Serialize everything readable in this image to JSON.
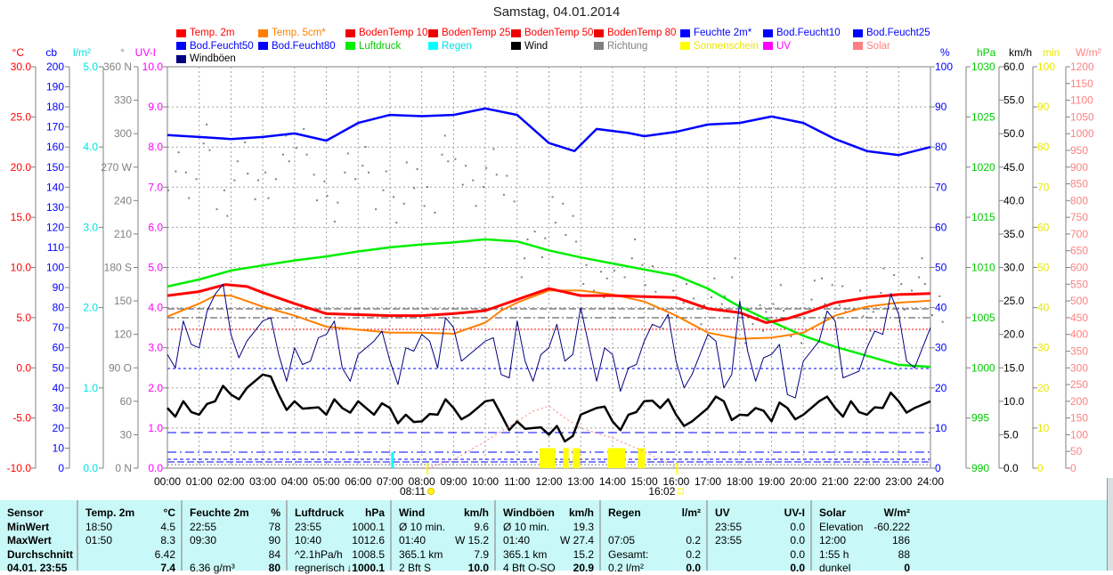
{
  "title": "Samstag, 04.01.2014",
  "legend": [
    {
      "label": "Temp. 2m",
      "color": "#ff0000",
      "text": "#ff0000"
    },
    {
      "label": "Temp. 5cm*",
      "color": "#ff8000",
      "text": "#ff8000"
    },
    {
      "label": "BodenTemp 10",
      "color": "#ee0000",
      "text": "#ff0000"
    },
    {
      "label": "BodenTemp 25",
      "color": "#ee0000",
      "text": "#ff0000"
    },
    {
      "label": "BodenTemp 50",
      "color": "#ee0000",
      "text": "#ff0000"
    },
    {
      "label": "BodenTemp 80",
      "color": "#ee0000",
      "text": "#ff0000"
    },
    {
      "label": "Feuchte 2m*",
      "color": "#0000ff",
      "text": "#0000ff"
    },
    {
      "label": "Bod.Feucht10",
      "color": "#0000ff",
      "text": "#0000ff"
    },
    {
      "label": "Bod.Feucht25",
      "color": "#0000ff",
      "text": "#0000ff"
    },
    {
      "label": "Bod.Feucht50",
      "color": "#0000ff",
      "text": "#0000ff"
    },
    {
      "label": "Bod.Feucht80",
      "color": "#0000ff",
      "text": "#0000ff"
    },
    {
      "label": "Luftdruck",
      "color": "#00ee00",
      "text": "#00cc00"
    },
    {
      "label": "Regen",
      "color": "#00ffff",
      "text": "#00e0e0"
    },
    {
      "label": "Wind",
      "color": "#000000",
      "text": "#000000"
    },
    {
      "label": "Richtung",
      "color": "#808080",
      "text": "#808080"
    },
    {
      "label": "Sonnenschein",
      "color": "#ffff00",
      "text": "#e8e800"
    },
    {
      "label": "UV",
      "color": "#ff00ff",
      "text": "#ff00ff"
    },
    {
      "label": "Solar",
      "color": "#ff8080",
      "text": "#ff8080"
    },
    {
      "label": "Windböen",
      "color": "#000080",
      "text": "#000000"
    }
  ],
  "chart_data": {
    "type": "line",
    "title": "Samstag, 04.01.2014",
    "x_ticks": [
      "00:00",
      "01:00",
      "02:00",
      "03:00",
      "04:00",
      "05:00",
      "06:00",
      "07:00",
      "08:00",
      "09:00",
      "10:00",
      "11:00",
      "12:00",
      "13:00",
      "14:00",
      "15:00",
      "16:00",
      "17:00",
      "18:00",
      "19:00",
      "20:00",
      "21:00",
      "22:00",
      "23:00",
      "24:00"
    ],
    "xlim": [
      0,
      24
    ],
    "sunrise": "08:11",
    "sunset": "16:02",
    "sunrise_h": 8.18,
    "sunset_h": 16.03,
    "axes": {
      "C": {
        "title": "°C",
        "color": "#ff0000",
        "range": [
          -10,
          30
        ],
        "labels": [
          "30.0",
          "25.0",
          "20.0",
          "15.0",
          "10.0",
          "5.0",
          "0.0",
          "-5.0",
          "-10.0"
        ]
      },
      "cb": {
        "title": "cb",
        "color": "#0000ff",
        "range": [
          0,
          200
        ],
        "labels": [
          "200",
          "190",
          "180",
          "170",
          "160",
          "150",
          "140",
          "130",
          "120",
          "110",
          "100",
          "90",
          "80",
          "70",
          "60",
          "50",
          "40",
          "30",
          "20",
          "10",
          "0"
        ]
      },
      "lm2": {
        "title": "l/m²",
        "color": "#00e0e0",
        "range": [
          0,
          5
        ],
        "labels": [
          "5.0",
          "4.0",
          "3.0",
          "2.0",
          "1.0",
          "0.0"
        ]
      },
      "deg": {
        "title": "°",
        "color": "#808080",
        "range": [
          0,
          360
        ],
        "labels": [
          "360 N",
          "330",
          "300",
          "270 W",
          "240",
          "210",
          "180 S",
          "150",
          "120",
          "90 O",
          "60",
          "30",
          "0 N"
        ]
      },
      "uvi": {
        "title": "UV-I",
        "color": "#ff00ff",
        "range": [
          0,
          10
        ],
        "labels": [
          "10.0",
          "9.0",
          "8.0",
          "7.0",
          "6.0",
          "5.0",
          "4.0",
          "3.0",
          "2.0",
          "1.0",
          "0.0"
        ]
      },
      "pct": {
        "title": "%",
        "color": "#0000ff",
        "range": [
          0,
          100
        ],
        "labels": [
          "100",
          "90",
          "80",
          "70",
          "60",
          "50",
          "40",
          "30",
          "20",
          "10",
          "0"
        ]
      },
      "hpa": {
        "title": "hPa",
        "color": "#00cc00",
        "range": [
          990,
          1030
        ],
        "labels": [
          "1030",
          "1025",
          "1020",
          "1015",
          "1010",
          "1005",
          "1000",
          "995",
          "990"
        ]
      },
      "kmh": {
        "title": "km/h",
        "color": "#000000",
        "range": [
          0,
          60
        ],
        "labels": [
          "60.0",
          "55.0",
          "50.0",
          "45.0",
          "40.0",
          "35.0",
          "30.0",
          "25.0",
          "20.0",
          "15.0",
          "10.0",
          "5.0",
          "0.0"
        ]
      },
      "min": {
        "title": "min",
        "color": "#e8e800",
        "range": [
          0,
          100
        ],
        "labels": [
          "100",
          "90",
          "80",
          "70",
          "60",
          "50",
          "40",
          "30",
          "20",
          "10",
          "0"
        ]
      },
      "wm2": {
        "title": "W/m²",
        "color": "#ff8080",
        "range": [
          0,
          1200
        ],
        "labels": [
          "1200",
          "1150",
          "1100",
          "1050",
          "1000",
          "950",
          "900",
          "850",
          "800",
          "750",
          "700",
          "650",
          "600",
          "550",
          "500",
          "450",
          "400",
          "350",
          "300",
          "250",
          "200",
          "150",
          "100",
          "50",
          "0"
        ]
      }
    },
    "series": [
      {
        "name": "Feuchte 2m*",
        "axis": "pct",
        "color": "#0000ff",
        "width": 2.5,
        "x": [
          0,
          1,
          2,
          3,
          4,
          5,
          6,
          7,
          8,
          9,
          10,
          11,
          12,
          12.8,
          13.5,
          14.5,
          15,
          16,
          17,
          18,
          19,
          20,
          21,
          22,
          23,
          24
        ],
        "y": [
          83,
          82.5,
          82,
          82.5,
          83.4,
          81.6,
          86,
          88,
          87.7,
          88,
          89.6,
          88,
          81,
          79,
          84.5,
          83.5,
          82.7,
          83.8,
          85.6,
          86,
          87.6,
          86,
          82,
          79,
          78,
          80
        ]
      },
      {
        "name": "Luftdruck",
        "axis": "hpa",
        "color": "#00ee00",
        "width": 2.5,
        "x": [
          0,
          1,
          2,
          3,
          4,
          5,
          6,
          7,
          8,
          9,
          10,
          11,
          12,
          13,
          14,
          15,
          16,
          17,
          18,
          19,
          20,
          21,
          22,
          23,
          24
        ],
        "y": [
          1008.1,
          1008.8,
          1009.7,
          1010.2,
          1010.7,
          1011.1,
          1011.6,
          1012,
          1012.3,
          1012.5,
          1012.8,
          1012.6,
          1011.7,
          1011,
          1010.4,
          1009.8,
          1009.2,
          1007.9,
          1006.1,
          1004.6,
          1003.2,
          1002.1,
          1001.2,
          1000.3,
          1000.1
        ]
      },
      {
        "name": "Temp. 5cm*",
        "axis": "C",
        "color": "#ff8000",
        "width": 2,
        "x": [
          0,
          1,
          1.5,
          2,
          3,
          4,
          5,
          6,
          7,
          8,
          9,
          10,
          10.5,
          11,
          12,
          13,
          14,
          15,
          16,
          17,
          18,
          19,
          20,
          21,
          22,
          23,
          24
        ],
        "y": [
          5.1,
          6.4,
          7.2,
          7.2,
          6.1,
          5.2,
          4.1,
          3.8,
          3.5,
          3.5,
          3.4,
          4.5,
          5.7,
          6.5,
          7.7,
          7.7,
          7.3,
          6.6,
          5.2,
          3.5,
          2.9,
          3,
          3.5,
          5.2,
          6.1,
          6.5,
          6.7
        ]
      },
      {
        "name": "Temp. 2m",
        "axis": "C",
        "color": "#ff0000",
        "width": 3,
        "x": [
          0,
          1,
          1.83,
          2.5,
          3,
          4,
          5,
          6,
          7,
          8,
          9,
          10,
          11,
          12,
          13,
          14,
          15,
          16,
          17,
          18,
          18.83,
          19.5,
          20,
          21,
          22,
          23,
          24
        ],
        "y": [
          7.2,
          7.6,
          8.3,
          8.1,
          7.5,
          6.4,
          5.4,
          5.3,
          5.2,
          5.2,
          5.4,
          5.7,
          6.8,
          7.9,
          7.2,
          7.2,
          7.1,
          7,
          5.9,
          5.5,
          4.5,
          4.9,
          5.4,
          6.5,
          7,
          7.3,
          7.4
        ]
      },
      {
        "name": "Windböen",
        "axis": "kmh",
        "color": "#000080",
        "width": 1,
        "x": "half-hourly",
        "y": [
          17,
          22,
          18,
          26,
          20,
          19,
          22,
          17,
          18,
          16,
          20,
          15,
          17,
          19,
          16,
          18,
          20,
          15,
          21,
          17,
          19,
          14,
          22,
          13,
          18,
          16,
          24,
          13,
          17,
          15,
          19,
          21,
          16,
          14,
          20,
          12,
          25,
          13,
          17,
          11,
          16,
          19,
          22,
          14,
          18,
          20,
          23,
          15,
          21
        ]
      },
      {
        "name": "Wind",
        "axis": "kmh",
        "color": "#000000",
        "width": 2.5,
        "x": "half-hourly",
        "y": [
          9,
          10,
          8,
          10,
          11,
          12,
          14,
          11,
          10,
          9,
          8,
          9,
          10,
          8,
          9,
          8,
          7,
          8,
          9,
          8,
          10,
          8,
          7,
          6,
          5,
          4,
          8,
          9,
          7,
          8,
          10,
          9,
          8,
          7,
          9,
          10,
          8,
          9,
          7,
          9,
          8,
          10,
          9,
          10,
          8,
          9,
          10,
          9,
          10
        ]
      },
      {
        "name": "Solar",
        "axis": "wm2",
        "color": "#ff8080",
        "width": 1,
        "dash": "2,3",
        "x": [
          8.18,
          9,
          10,
          11,
          11.5,
          12,
          12.5,
          13,
          14,
          15,
          16.03
        ],
        "y": [
          0,
          25,
          80,
          140,
          170,
          186,
          150,
          120,
          90,
          50,
          0
        ]
      }
    ],
    "richtung": {
      "axis": "deg",
      "color": "#808080",
      "x": "half-hourly",
      "y": [
        270,
        255,
        290,
        240,
        275,
        250,
        260,
        285,
        300,
        245,
        235,
        265,
        280,
        250,
        230,
        270,
        240,
        295,
        260,
        250,
        270,
        255,
        190,
        200,
        240,
        215,
        180,
        160,
        170,
        190,
        175,
        145,
        160,
        150,
        160,
        170,
        120,
        140,
        150,
        130,
        155,
        160,
        145,
        150,
        140,
        165,
        160,
        175,
        150
      ]
    },
    "sonnenschein": {
      "axis": "min",
      "color": "#ffff00",
      "intervals": [
        [
          11.7,
          12.2
        ],
        [
          12.45,
          12.62
        ],
        [
          12.75,
          12.98
        ],
        [
          13.85,
          14.4
        ],
        [
          14.8,
          15.02
        ]
      ],
      "minutes": 5
    },
    "regen": {
      "axis": "lm2",
      "color": "#00ffff",
      "x": 7.08,
      "value": 0.2
    }
  },
  "table": [
    {
      "h": [
        "Sensor",
        ""
      ],
      "rows": [
        [
          "MinWert",
          ""
        ],
        [
          "MaxWert",
          ""
        ],
        [
          "Durchschnitt",
          ""
        ],
        [
          "04.01. 23:55",
          ""
        ]
      ]
    },
    {
      "h": [
        "Temp. 2m",
        "°C"
      ],
      "rows": [
        [
          "18:50",
          "4.5"
        ],
        [
          "01:50",
          "8.3"
        ],
        [
          "",
          "6.42"
        ],
        [
          "",
          "7.4"
        ]
      ]
    },
    {
      "h": [
        "Feuchte 2m",
        "%"
      ],
      "rows": [
        [
          "22:55",
          "78"
        ],
        [
          "09:30",
          "90"
        ],
        [
          "",
          "84"
        ],
        [
          "6.36 g/m³",
          "80"
        ]
      ]
    },
    {
      "h": [
        "Luftdruck",
        "hPa"
      ],
      "rows": [
        [
          "23:55",
          "1000.1"
        ],
        [
          "10:40",
          "1012.6"
        ],
        [
          "^2.1hPa/h",
          "1008.5"
        ],
        [
          "regnerisch",
          "↓1000.1"
        ]
      ]
    },
    {
      "h": [
        "Wind",
        "km/h"
      ],
      "rows": [
        [
          "Ø 10 min.",
          "9.6"
        ],
        [
          "01:40",
          "W 15.2"
        ],
        [
          "365.1 km",
          "7.9"
        ],
        [
          "2 Bft S",
          "10.0"
        ]
      ]
    },
    {
      "h": [
        "Windböen",
        "km/h"
      ],
      "rows": [
        [
          "Ø 10 min.",
          "19.3"
        ],
        [
          "01:40",
          "W 27.4"
        ],
        [
          "365.1 km",
          "15.2"
        ],
        [
          "4 Bft O-SO",
          "20.9"
        ]
      ]
    },
    {
      "h": [
        "Regen",
        "l/m²"
      ],
      "rows": [
        [
          "",
          ""
        ],
        [
          "07:05",
          "0.2"
        ],
        [
          "Gesamt:",
          "0.2"
        ],
        [
          "0.2 l/m²",
          "0.0"
        ]
      ]
    },
    {
      "h": [
        "UV",
        "UV-I"
      ],
      "rows": [
        [
          "23:55",
          "0.0"
        ],
        [
          "23:55",
          "0.0"
        ],
        [
          "",
          "0.0"
        ],
        [
          "",
          "0.0"
        ]
      ]
    },
    {
      "h": [
        "Solar",
        "W/m²"
      ],
      "rows": [
        [
          "Elevation",
          "-60.222"
        ],
        [
          "12:00",
          "186"
        ],
        [
          "1:55 h",
          "88"
        ],
        [
          "dunkel",
          "0"
        ]
      ]
    }
  ]
}
